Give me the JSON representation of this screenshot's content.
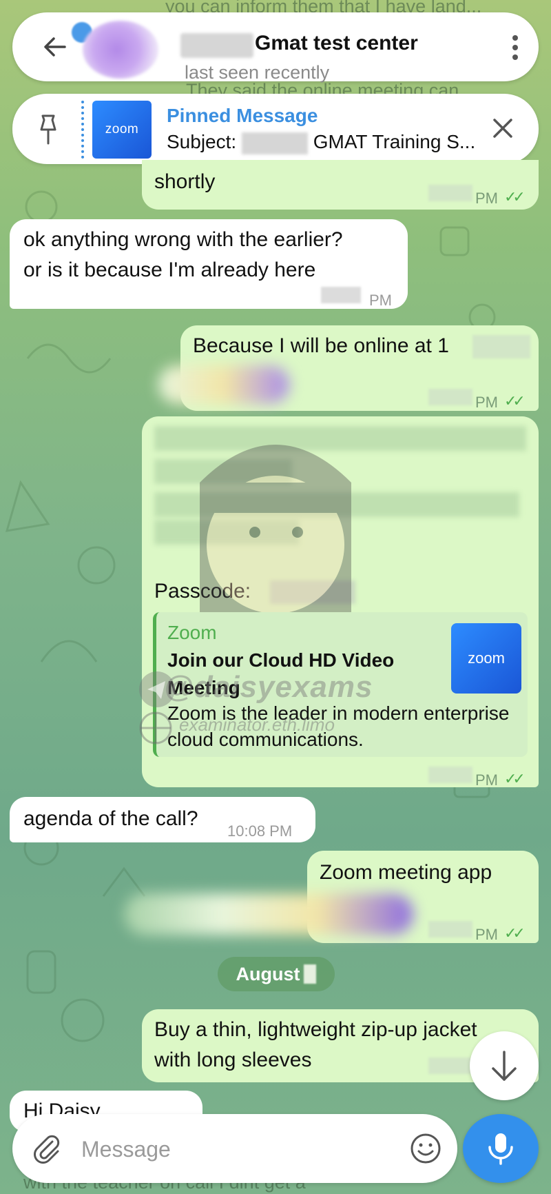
{
  "header": {
    "title": "Gmat test center",
    "status": "last seen recently"
  },
  "pinned": {
    "title": "Pinned Message",
    "subject_prefix": "Subject:",
    "subject_suffix": "GMAT Training S...",
    "thumb_label": "zoom"
  },
  "background_lines": {
    "top1": "you can inform them that I have land...",
    "top2": "They said the online meeting can",
    "bottom": "with the teacher on call I dint get a"
  },
  "messages": [
    {
      "dir": "out",
      "text": "shortly",
      "time": "PM"
    },
    {
      "dir": "in",
      "line1": "ok anything wrong with the earlier?",
      "line2": "or is it because I'm already here",
      "time": "PM"
    },
    {
      "dir": "out",
      "text": "Because I will be online at 1",
      "time": "PM"
    },
    {
      "dir": "out",
      "passcode_label": "Passcode:",
      "time": "PM"
    },
    {
      "dir": "in",
      "text": "agenda of the call?",
      "time": "10:08 PM"
    },
    {
      "dir": "out",
      "text": "Zoom meeting app",
      "time": "PM"
    },
    {
      "dir": "out",
      "line1": "Buy a thin, lightweight zip-up jacket",
      "line2": "with long sleeves"
    },
    {
      "dir": "in",
      "text": "Hi Daisy"
    }
  ],
  "link_preview": {
    "site": "Zoom",
    "title": "Join our Cloud HD Video Meeting",
    "description": "Zoom is the leader in modern enterprise cloud communications.",
    "thumb_label": "zoom"
  },
  "date_separator": "August",
  "watermark": {
    "handle": "@daisyexams",
    "site": "examinator.eth.limo"
  },
  "composer": {
    "placeholder": "Message"
  },
  "colors": {
    "accent": "#3390ec",
    "outgoing_bubble": "#dcf8c6",
    "incoming_bubble": "#ffffff",
    "check_green": "#4fae4e"
  }
}
